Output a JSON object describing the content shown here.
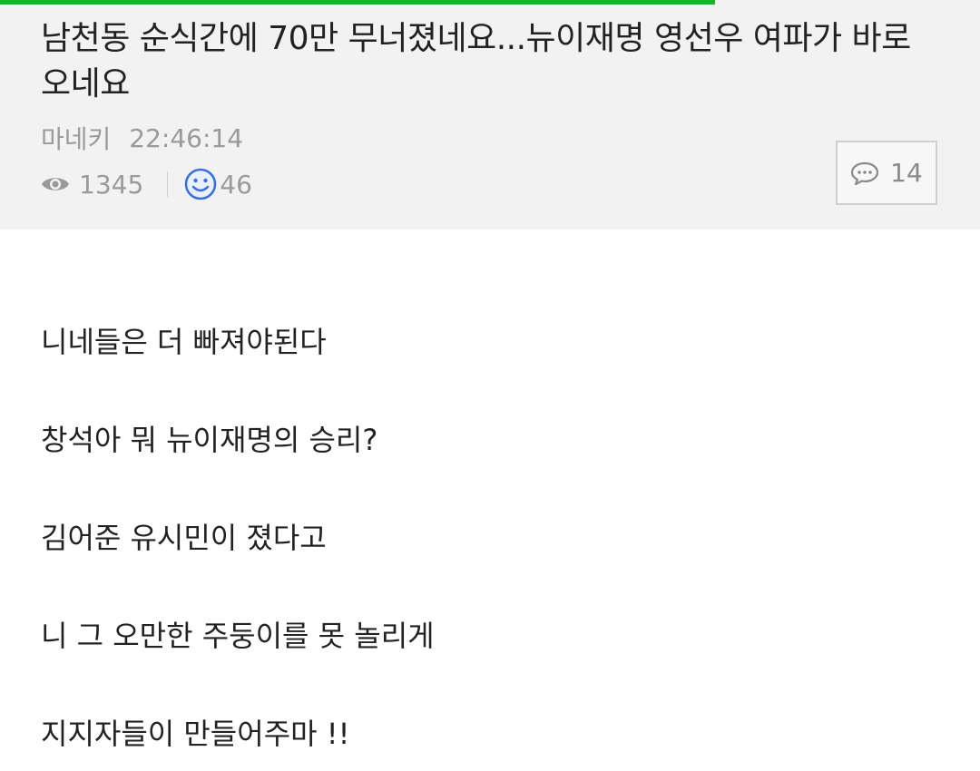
{
  "progress": {
    "percent": 73
  },
  "post": {
    "title": "남천동 순식간에 70만 무너졌네요...뉴이재명 영선우 여파가 바로 오네요",
    "author": "마네키",
    "time": "22:46:14",
    "views": "1345",
    "likes": "46",
    "comments": "14"
  },
  "icons": {
    "views": "eye-icon",
    "likes": "smile-icon",
    "comments": "speech-bubble-icon"
  },
  "colors": {
    "progress": "#1bb12b",
    "header_bg": "#f2f2f2",
    "like_icon": "#3a6fd8"
  },
  "body": {
    "paragraphs": [
      "니네들은 더 빠져야된다",
      "창석아 뭐 뉴이재명의 승리?",
      "김어준 유시민이 졌다고",
      "니 그 오만한 주둥이를 못 놀리게",
      "지지자들이 만들어주마 !!"
    ]
  }
}
